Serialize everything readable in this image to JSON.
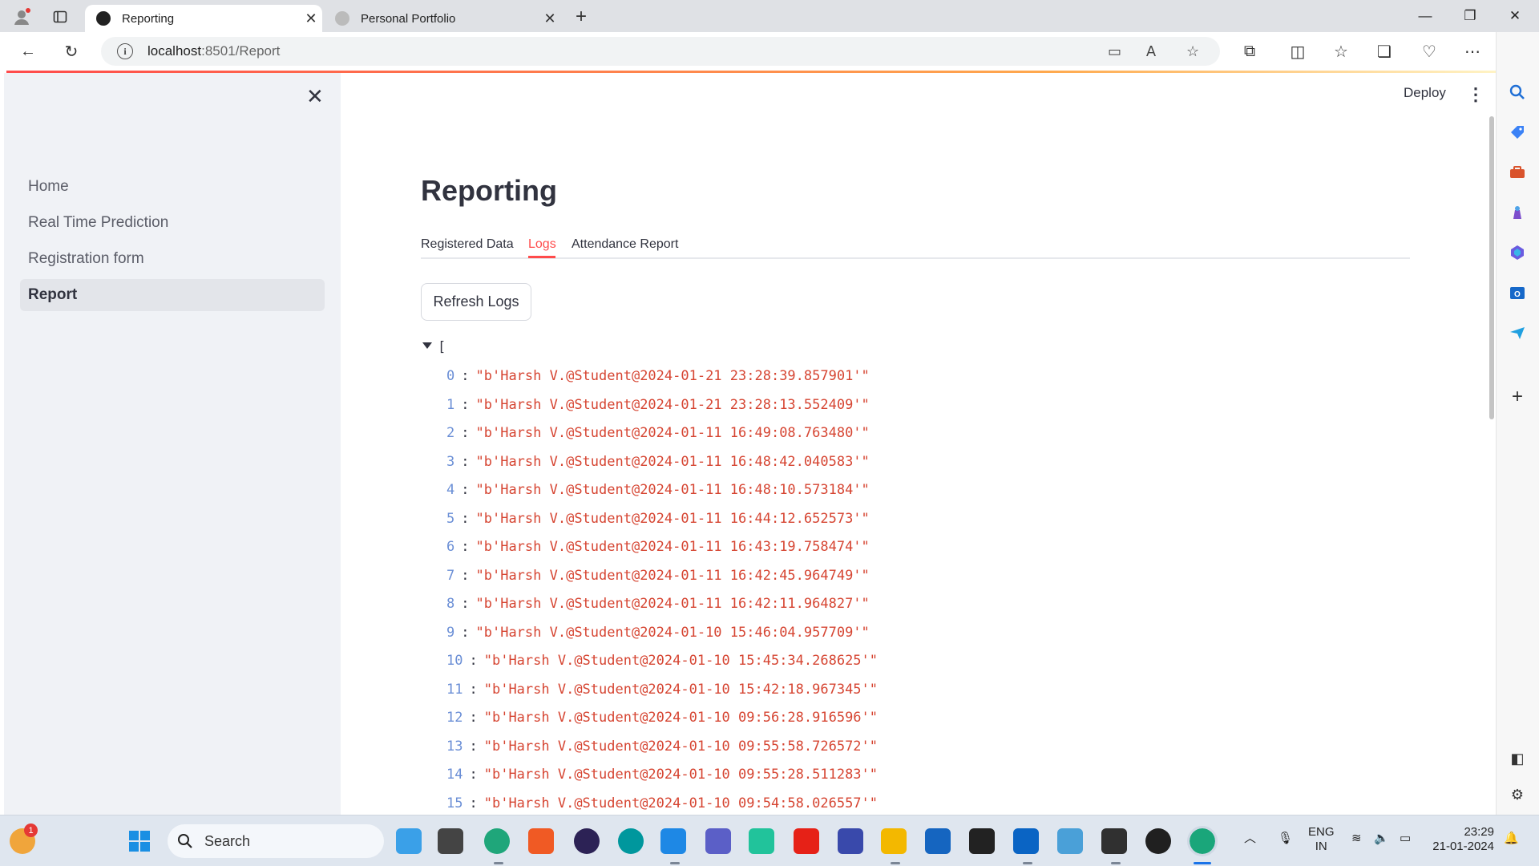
{
  "browser": {
    "tabs": [
      {
        "title": "Reporting",
        "active": true
      },
      {
        "title": "Personal Portfolio",
        "active": false
      }
    ],
    "url_host": "localhost",
    "url_path": ":8501/Report"
  },
  "sidebar": {
    "items": [
      {
        "label": "Home"
      },
      {
        "label": "Real Time Prediction"
      },
      {
        "label": "Registration form"
      },
      {
        "label": "Report",
        "active": true
      }
    ]
  },
  "header": {
    "deploy_label": "Deploy",
    "menu_glyph": "⋮"
  },
  "main": {
    "title": "Reporting",
    "tabs": [
      {
        "label": "Registered Data"
      },
      {
        "label": "Logs",
        "active": true
      },
      {
        "label": "Attendance Report"
      }
    ],
    "refresh_label": "Refresh Logs",
    "json_open": "[",
    "logs": [
      {
        "index": "0",
        "value": "\"b'Harsh V.@Student@2024-01-21 23:28:39.857901'\""
      },
      {
        "index": "1",
        "value": "\"b'Harsh V.@Student@2024-01-21 23:28:13.552409'\""
      },
      {
        "index": "2",
        "value": "\"b'Harsh V.@Student@2024-01-11 16:49:08.763480'\""
      },
      {
        "index": "3",
        "value": "\"b'Harsh V.@Student@2024-01-11 16:48:42.040583'\""
      },
      {
        "index": "4",
        "value": "\"b'Harsh V.@Student@2024-01-11 16:48:10.573184'\""
      },
      {
        "index": "5",
        "value": "\"b'Harsh V.@Student@2024-01-11 16:44:12.652573'\""
      },
      {
        "index": "6",
        "value": "\"b'Harsh V.@Student@2024-01-11 16:43:19.758474'\""
      },
      {
        "index": "7",
        "value": "\"b'Harsh V.@Student@2024-01-11 16:42:45.964749'\""
      },
      {
        "index": "8",
        "value": "\"b'Harsh V.@Student@2024-01-11 16:42:11.964827'\""
      },
      {
        "index": "9",
        "value": "\"b'Harsh V.@Student@2024-01-10 15:46:04.957709'\""
      },
      {
        "index": "10",
        "value": "\"b'Harsh V.@Student@2024-01-10 15:45:34.268625'\""
      },
      {
        "index": "11",
        "value": "\"b'Harsh V.@Student@2024-01-10 15:42:18.967345'\""
      },
      {
        "index": "12",
        "value": "\"b'Harsh V.@Student@2024-01-10 09:56:28.916596'\""
      },
      {
        "index": "13",
        "value": "\"b'Harsh V.@Student@2024-01-10 09:55:58.726572'\""
      },
      {
        "index": "14",
        "value": "\"b'Harsh V.@Student@2024-01-10 09:55:28.511283'\""
      },
      {
        "index": "15",
        "value": "\"b'Harsh V.@Student@2024-01-10 09:54:58.026557'\""
      }
    ]
  },
  "taskbar": {
    "search_label": "Search",
    "notification_badge": "1",
    "language": "ENG",
    "region": "IN",
    "time": "23:29",
    "date": "21-01-2024"
  },
  "colors": {
    "accent": "#ff4b4b",
    "json_value": "#d64532",
    "json_index": "#6b8fd6",
    "sidebar_bg": "#f0f2f6"
  }
}
